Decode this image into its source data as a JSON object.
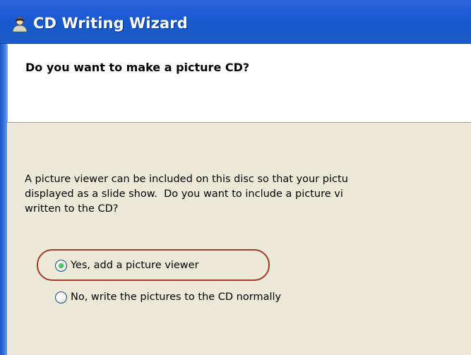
{
  "window": {
    "title": "CD Writing Wizard",
    "title_icon": "cd-writer-person-icon"
  },
  "header": {
    "question": "Do you want to make a picture CD?"
  },
  "body": {
    "line1": "A picture viewer can be included on this disc so that your pictu",
    "line2": "displayed as a slide show.  Do you want to include a picture vi",
    "line3": "written to the CD?"
  },
  "options": [
    {
      "label": "Yes, add a picture viewer",
      "selected": true
    },
    {
      "label": "No, write the pictures to the CD normally",
      "selected": false
    }
  ],
  "colors": {
    "titlebar": "#1f5bd6",
    "dialog_bg": "#ece9d8",
    "highlight_ring": "#a23a2a"
  }
}
